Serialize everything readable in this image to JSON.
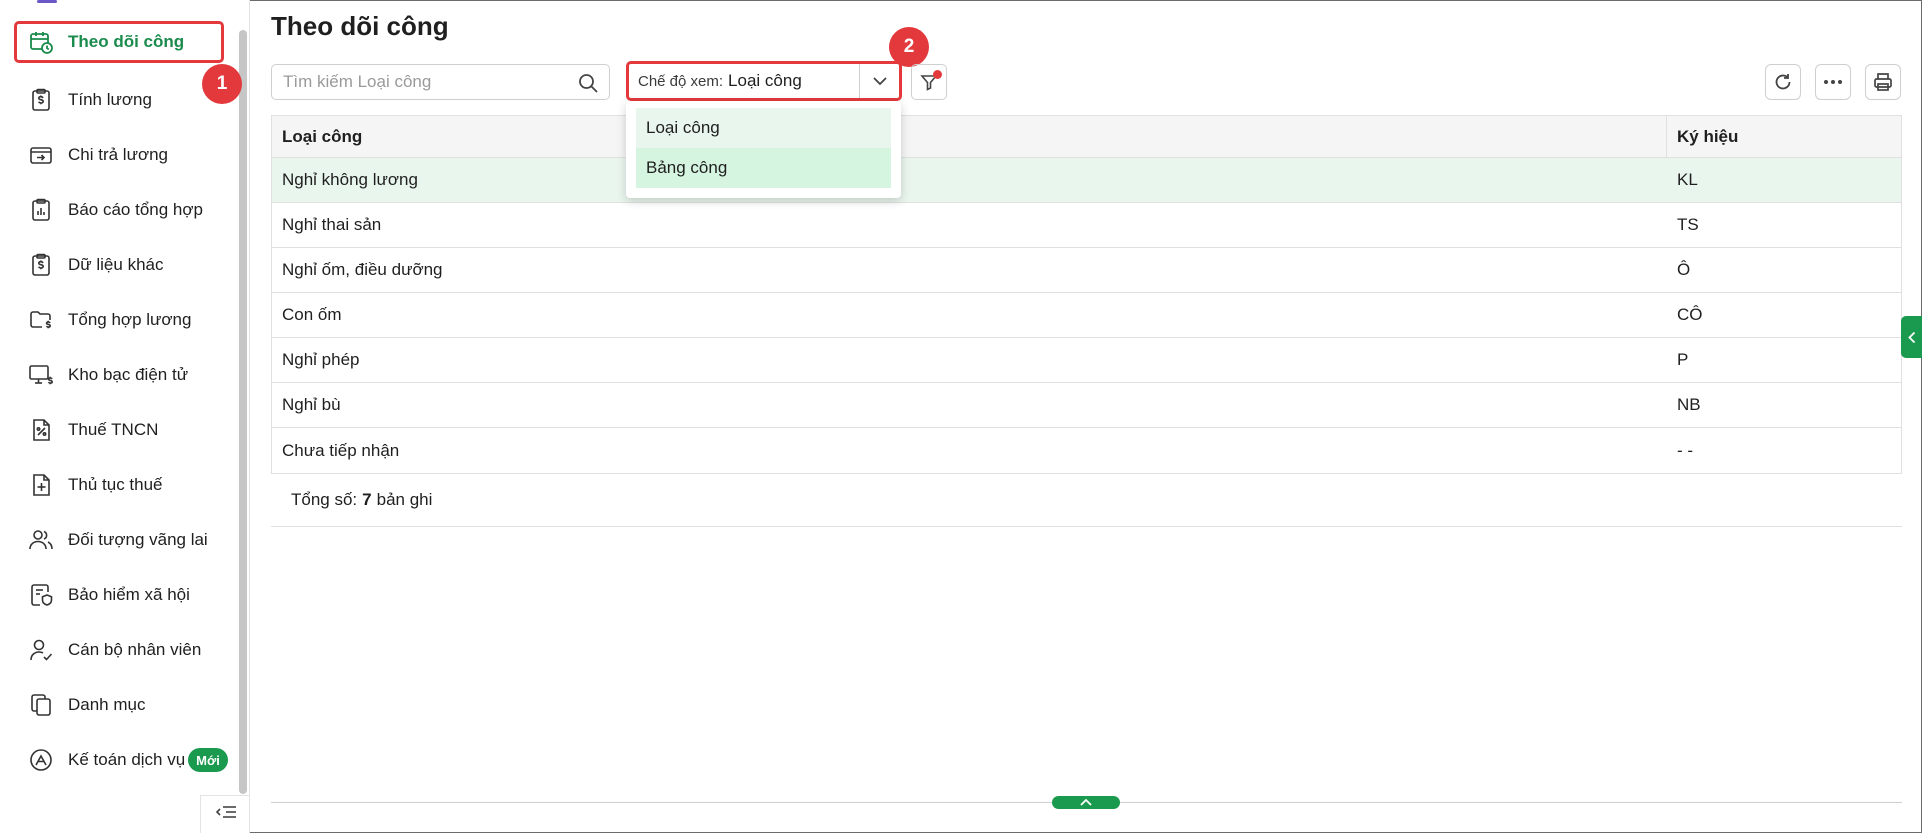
{
  "sidebar": {
    "items": [
      {
        "label": "Theo dõi công",
        "icon": "calendar-clock-icon"
      },
      {
        "label": "Tính lương",
        "icon": "salary-clipboard-icon"
      },
      {
        "label": "Chi trả lương",
        "icon": "wallet-transfer-icon"
      },
      {
        "label": "Báo cáo tổng hợp",
        "icon": "report-chart-icon"
      },
      {
        "label": "Dữ liệu khác",
        "icon": "dollar-clipboard-icon"
      },
      {
        "label": "Tổng hợp lương",
        "icon": "folder-dollar-icon"
      },
      {
        "label": "Kho bạc điện tử",
        "icon": "monitor-dollar-icon"
      },
      {
        "label": "Thuế TNCN",
        "icon": "tax-percent-icon"
      },
      {
        "label": "Thủ tục thuế",
        "icon": "document-plus-icon"
      },
      {
        "label": "Đối tượng vãng lai",
        "icon": "people-icon"
      },
      {
        "label": "Bảo hiểm xã hội",
        "icon": "insurance-shield-icon"
      },
      {
        "label": "Cán bộ nhân viên",
        "icon": "user-check-icon"
      },
      {
        "label": "Danh mục",
        "icon": "copy-docs-icon"
      },
      {
        "label": "Kế toán dịch vụ",
        "icon": "service-accounting-icon"
      }
    ],
    "new_badge": "Mới",
    "active_color": "#1a8b4c"
  },
  "steps": {
    "one": "1",
    "two": "2"
  },
  "main": {
    "title": "Theo dõi công",
    "search_placeholder": "Tìm kiếm Loại công",
    "view_mode_label": "Chế độ xem:",
    "view_mode_value": "Loại công",
    "dropdown_options": [
      "Loại công",
      "Bảng công"
    ]
  },
  "table": {
    "headers": [
      "Loại công",
      "Ký hiệu"
    ],
    "rows": [
      {
        "name": "Nghỉ không lương",
        "code": "KL"
      },
      {
        "name": "Nghỉ thai sản",
        "code": "TS"
      },
      {
        "name": "Nghỉ ốm, điều dưỡng",
        "code": "Ô"
      },
      {
        "name": "Con ốm",
        "code": "CÔ"
      },
      {
        "name": "Nghỉ phép",
        "code": "P"
      },
      {
        "name": "Nghỉ bù",
        "code": "NB"
      },
      {
        "name": "Chưa tiếp nhận",
        "code": "- -"
      }
    ]
  },
  "footer": {
    "total_prefix": "Tổng số:",
    "total_count": "7",
    "total_suffix": "bản ghi"
  },
  "colors": {
    "accent": "#1a9a4e",
    "highlight": "#e4393c"
  }
}
